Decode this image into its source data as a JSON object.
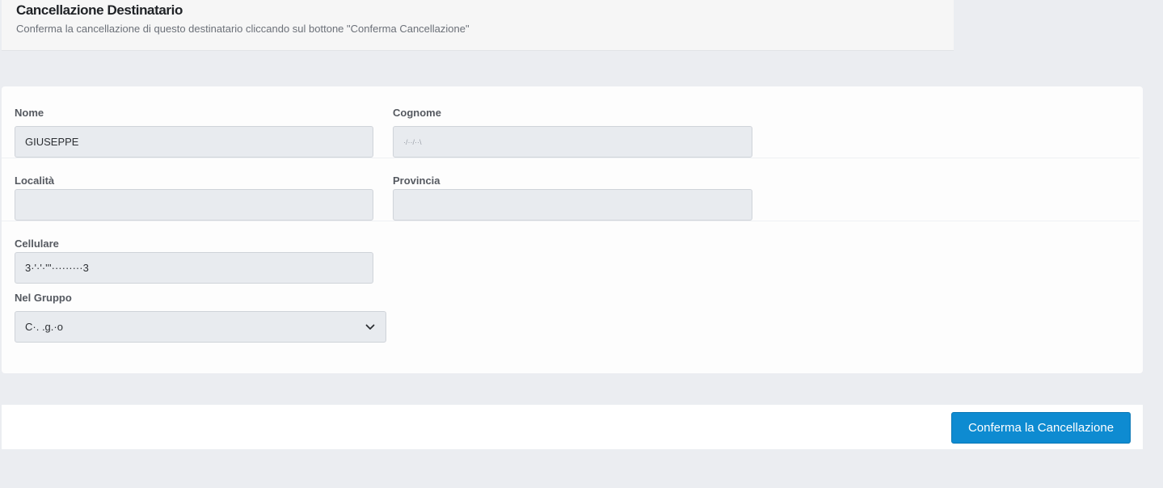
{
  "header": {
    "title": "Cancellazione Destinatario",
    "subtitle": "Conferma la cancellazione di questo destinatario cliccando sul bottone \"Conferma Cancellazione\""
  },
  "form": {
    "nome": {
      "label": "Nome",
      "value": "GIUSEPPE"
    },
    "cognome": {
      "label": "Cognome",
      "value": "·/··/··\\"
    },
    "localita": {
      "label": "Località",
      "value": ""
    },
    "provincia": {
      "label": "Provincia",
      "value": ""
    },
    "cellulare": {
      "label": "Cellulare",
      "value": "3·'·'·'''·········3"
    },
    "gruppo": {
      "label": "Nel Gruppo",
      "value": "C·.           .g.·o",
      "icon": "chevron-down-icon"
    }
  },
  "footer": {
    "confirm_label": "Conferma la Cancellazione"
  },
  "colors": {
    "background": "#ebedf1",
    "accent": "#0e8bd1",
    "input_bg": "#e8ebef"
  }
}
